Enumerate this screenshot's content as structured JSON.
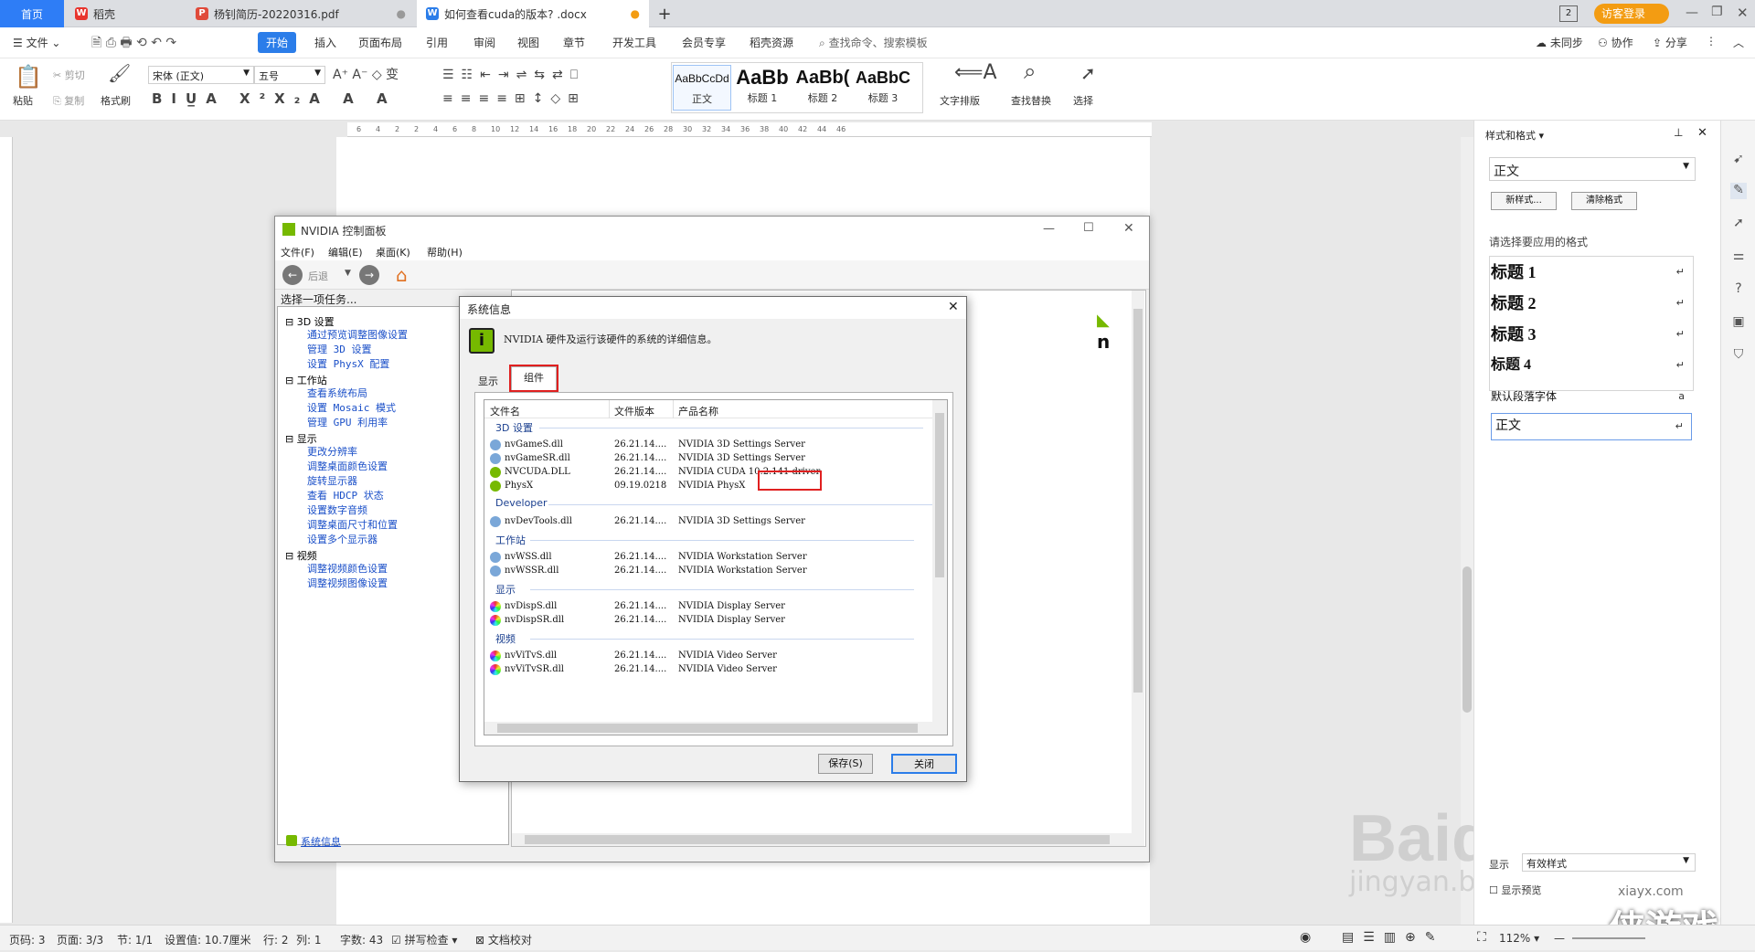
{
  "tabs": [
    {
      "label": "首页",
      "active": false
    },
    {
      "label": "稻壳",
      "active": false
    },
    {
      "label": "杨钊简历-20220316.pdf",
      "active": false
    },
    {
      "label": "如何查看cuda的版本? .docx",
      "active": true
    }
  ],
  "topright": {
    "login": "访客登录",
    "page_num": "2"
  },
  "menu": {
    "file": "文件",
    "items": [
      "开始",
      "插入",
      "页面布局",
      "引用",
      "审阅",
      "视图",
      "章节",
      "开发工具",
      "会员专享",
      "稻壳资源"
    ],
    "search_placeholder": "查找命令、搜索模板",
    "sync": "未同步",
    "collab": "协作",
    "share": "分享"
  },
  "ribbon": {
    "paste": "粘贴",
    "cut": "剪切",
    "copy": "复制",
    "format_painter": "格式刷",
    "font_name": "宋体 (正文)",
    "font_size": "五号",
    "styles": [
      {
        "preview": "AaBbCcDd",
        "label": "正文"
      },
      {
        "preview": "AaBb",
        "label": "标题 1"
      },
      {
        "preview": "AaBb(",
        "label": "标题 2"
      },
      {
        "preview": "AaBbC",
        "label": "标题 3"
      }
    ],
    "text_layout": "文字排版",
    "find_replace": "查找替换",
    "select": "选择"
  },
  "ruler_ticks": [
    "6",
    "4",
    "2",
    "2",
    "4",
    "6",
    "8",
    "10",
    "12",
    "14",
    "16",
    "18",
    "20",
    "22",
    "24",
    "26",
    "28",
    "30",
    "32",
    "34",
    "36",
    "38",
    "40",
    "42",
    "44",
    "46"
  ],
  "nvidia": {
    "title": "NVIDIA 控制面板",
    "menu": [
      "文件(F)",
      "编辑(E)",
      "桌面(K)",
      "帮助(H)"
    ],
    "back": "后退",
    "task_title": "选择一项任务...",
    "tree": [
      {
        "cat": "3D 设置",
        "links": [
          "通过预览调整图像设置",
          "管理 3D 设置",
          "设置 PhysX 配置"
        ]
      },
      {
        "cat": "工作站",
        "links": [
          "查看系统布局",
          "设置 Mosaic 模式",
          "管理 GPU 利用率"
        ]
      },
      {
        "cat": "显示",
        "links": [
          "更改分辨率",
          "调整桌面颜色设置",
          "旋转显示器",
          "查看 HDCP 状态",
          "设置数字音频",
          "调整桌面尺寸和位置",
          "设置多个显示器"
        ]
      },
      {
        "cat": "视频",
        "links": [
          "调整视频颜色设置",
          "调整视频图像设置"
        ]
      }
    ],
    "sysinfo_link": "系统信息"
  },
  "dialog": {
    "title": "系统信息",
    "desc": "NVIDIA 硬件及运行该硬件的系统的详细信息。",
    "tab_display": "显示",
    "tab_components": "组件",
    "columns": [
      "文件名",
      "文件版本",
      "产品名称"
    ],
    "groups": [
      {
        "name": "3D 设置",
        "rows": [
          [
            "nvGameS.dll",
            "26.21.14....",
            "NVIDIA 3D Settings Server"
          ],
          [
            "nvGameSR.dll",
            "26.21.14....",
            "NVIDIA 3D Settings Server"
          ],
          [
            "NVCUDA.DLL",
            "26.21.14....",
            "NVIDIA CUDA 10.2.141 driver"
          ],
          [
            "PhysX",
            "09.19.0218",
            "NVIDIA PhysX"
          ]
        ]
      },
      {
        "name": "Developer",
        "rows": [
          [
            "nvDevTools.dll",
            "26.21.14....",
            "NVIDIA 3D Settings Server"
          ]
        ]
      },
      {
        "name": "工作站",
        "rows": [
          [
            "nvWSS.dll",
            "26.21.14....",
            "NVIDIA Workstation Server"
          ],
          [
            "nvWSSR.dll",
            "26.21.14....",
            "NVIDIA Workstation Server"
          ]
        ]
      },
      {
        "name": "显示",
        "rows": [
          [
            "nvDispS.dll",
            "26.21.14....",
            "NVIDIA Display Server"
          ],
          [
            "nvDispSR.dll",
            "26.21.14....",
            "NVIDIA Display Server"
          ]
        ]
      },
      {
        "name": "视频",
        "rows": [
          [
            "nvViTvS.dll",
            "26.21.14....",
            "NVIDIA Video Server"
          ],
          [
            "nvViTvSR.dll",
            "26.21.14....",
            "NVIDIA Video Server"
          ]
        ]
      }
    ],
    "save": "保存(S)",
    "close": "关闭"
  },
  "sidepanel": {
    "title": "样式和格式",
    "current_style": "正文",
    "new_style": "新样式...",
    "clear_format": "清除格式",
    "apply_label": "请选择要应用的格式",
    "styles": [
      "标题 1",
      "标题 2",
      "标题 3",
      "标题 4"
    ],
    "default_font": "默认段落字体",
    "body": "正文",
    "show_label": "显示",
    "show_value": "有效样式",
    "preview_label": "显示预览"
  },
  "status": {
    "page_count": "页码: 3",
    "page": "页面: 3/3",
    "section": "节: 1/1",
    "setting": "设置值: 10.7厘米",
    "line": "行: 2",
    "col": "列: 1",
    "words": "字数: 43",
    "spell": "拼写检查",
    "proof": "文档校对",
    "zoom": "112%"
  },
  "watermark": {
    "brand": "Baidu经验",
    "url": "jingyan.baidu.com",
    "site": "xiayx.com",
    "site_cn": "侠游戏"
  },
  "colors": {
    "accent": "#2b7de9",
    "nvidia_green": "#76b900",
    "highlight": "#e02020"
  }
}
